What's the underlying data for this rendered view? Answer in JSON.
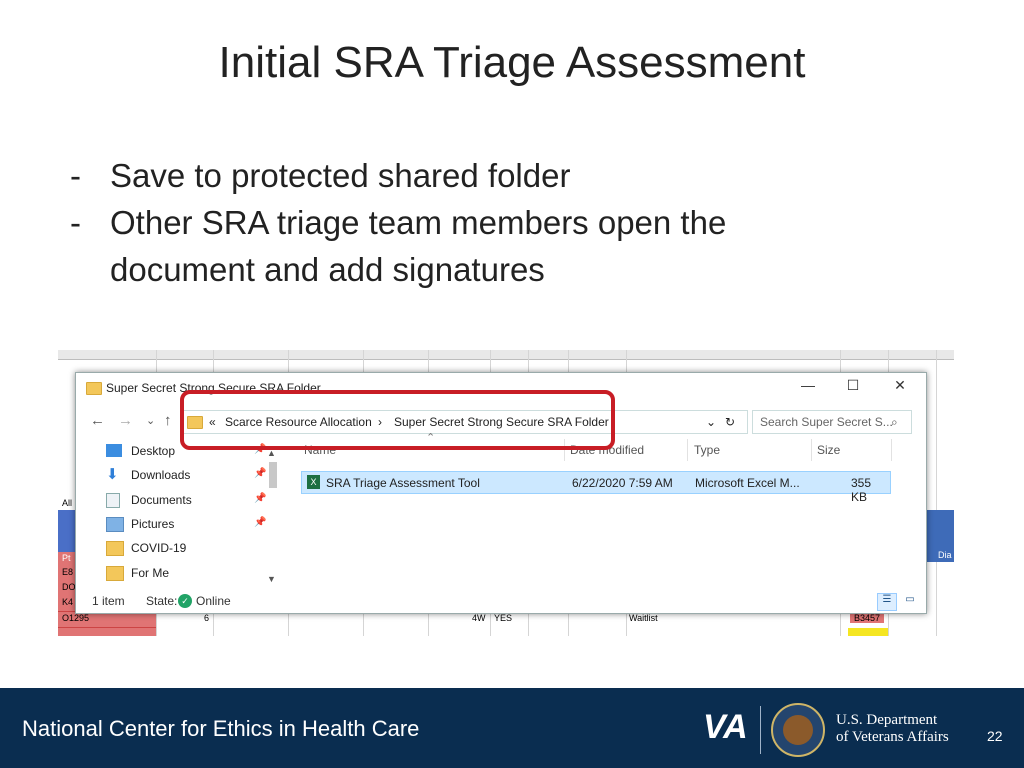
{
  "slide": {
    "title": "Initial SRA Triage Assessment",
    "bullets": [
      {
        "dash": "-",
        "text": "Save to protected shared folder"
      },
      {
        "dash": "-",
        "text": "Other SRA triage team members open the document and add signatures"
      }
    ]
  },
  "sheet": {
    "row_label": "O1295",
    "row_col_b": "6",
    "row_col_g": "4W",
    "row_col_h": "YES",
    "row_col_k": "Waitlist",
    "row_col_l": "B3457",
    "left_cells": [
      "Pt",
      "E8",
      "DO",
      "K4"
    ],
    "left_label": "All",
    "right_label": "Dia"
  },
  "explorer": {
    "title": "Super Secret Strong Secure SRA Folder",
    "controls": {
      "minimize": "—",
      "maximize": "☐",
      "close": "✕"
    },
    "nav": {
      "back": "←",
      "forward": "→",
      "recent": "⌄",
      "up": "↑"
    },
    "address": {
      "overflow": "«",
      "segment1": "Scarce Resource Allocation",
      "separator": "›",
      "segment2": "Super Secret Strong Secure SRA Folder",
      "dropdown": "⌄",
      "refresh": "↻"
    },
    "search": {
      "placeholder": "Search Super Secret S...",
      "icon": "search-icon"
    },
    "nav_items": [
      {
        "label": "Desktop",
        "icon": "desktop-icon",
        "pinned": true
      },
      {
        "label": "Downloads",
        "icon": "download-icon",
        "pinned": true
      },
      {
        "label": "Documents",
        "icon": "documents-icon",
        "pinned": true
      },
      {
        "label": "Pictures",
        "icon": "pictures-icon",
        "pinned": true
      },
      {
        "label": "COVID-19",
        "icon": "folder-icon",
        "pinned": false
      },
      {
        "label": "For Me",
        "icon": "folder-icon",
        "pinned": false
      }
    ],
    "columns": [
      "Name",
      "Date modified",
      "Type",
      "Size"
    ],
    "files": [
      {
        "name": "SRA Triage Assessment Tool",
        "date": "6/22/2020 7:59 AM",
        "type": "Microsoft Excel M...",
        "size": "355 KB"
      }
    ],
    "status": {
      "count": "1 item",
      "state_label": "State:",
      "state_value": "Online"
    }
  },
  "footer": {
    "org": "National Center for Ethics in Health Care",
    "va_logo": "VA",
    "dept_line1": "U.S. Department",
    "dept_line2": "of Veterans Affairs",
    "page": "22"
  },
  "colors": {
    "footer_bg": "#0a2d50",
    "highlight": "#c81d25",
    "selection": "#cce8ff",
    "excel_green": "#1d6f42"
  }
}
